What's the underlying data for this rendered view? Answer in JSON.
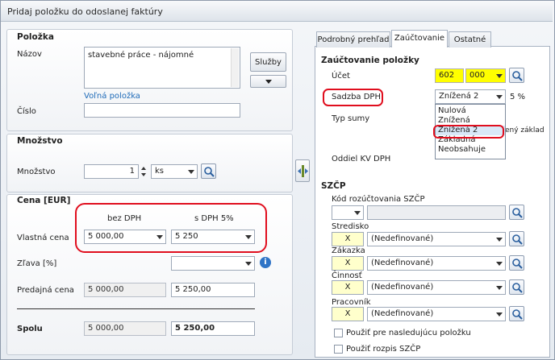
{
  "window": {
    "title": "Pridaj položku do odoslanej faktúry"
  },
  "polozka": {
    "title": "Položka",
    "nazov_label": "Názov",
    "nazov_value": "stavebné práce - nájomné",
    "sluzby_label": "Služby",
    "volna_polozka": "Voľná položka",
    "cislo_label": "Číslo",
    "cislo_value": ""
  },
  "mnozstvo": {
    "title": "Množstvo",
    "label": "Množstvo",
    "value": "1",
    "unit": "ks"
  },
  "cena": {
    "title": "Cena [EUR]",
    "col_bez": "bez DPH",
    "col_s": "s DPH 5%",
    "vlastna_label": "Vlastná cena",
    "vlastna_bez": "5 000,00",
    "vlastna_s": "5 250",
    "zlava_label": "Zľava [%]",
    "zlava_value": "",
    "predajna_label": "Predajná cena",
    "predajna_bez": "5 000,00",
    "predajna_s": "5 250,00",
    "spolu_label": "Spolu",
    "spolu_bez": "5 000,00",
    "spolu_s": "5 250,00"
  },
  "tabs": [
    {
      "label": "Podrobný prehľad"
    },
    {
      "label": "Zaúčtovanie"
    },
    {
      "label": "Ostatné"
    }
  ],
  "zauctovanie": {
    "title": "Zaúčtovanie položky",
    "ucet_label": "Účet",
    "ucet_syn": "602",
    "ucet_an": "000",
    "sadzba_label": "Sadzba DPH",
    "sadzba_value": "Znížená 2",
    "sadzba_pct": "5 %",
    "typ_sumy_label": "Typ sumy",
    "typ_sumy_partial": "ený základ",
    "oddiel_label": "Oddiel KV DPH",
    "dropdown_options": [
      "Nulová",
      "Znížená",
      "Znížená 2",
      "Základná",
      "Neobsahuje"
    ],
    "dropdown_selected": "Znížená 2"
  },
  "szcp": {
    "title": "SZČP",
    "kod_label": "Kód rozúčtovania SZČP",
    "kod_value": "",
    "stredisko_label": "Stredisko",
    "zakazka_label": "Zákazka",
    "cinnost_label": "Činnosť",
    "pracovnik_label": "Pracovník",
    "x": "X",
    "nedef": "(Nedefinované)",
    "pouzit_polozku": "Použiť pre nasledujúcu položku",
    "pouzit_rozpis": "Použiť rozpis SZČP"
  }
}
